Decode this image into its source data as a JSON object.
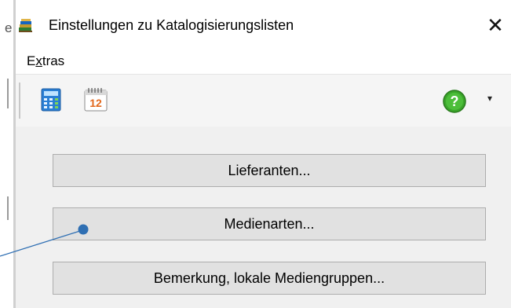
{
  "window": {
    "title": "Einstellungen zu Katalogisierungslisten",
    "close_symbol": "✕"
  },
  "background_window": {
    "partial_char": "e"
  },
  "menu": {
    "items": [
      {
        "label_pre": "E",
        "label_u": "x",
        "label_post": "tras"
      }
    ]
  },
  "toolbar": {
    "buttons": [
      {
        "icon": "calculator-icon"
      },
      {
        "icon": "calendar-icon",
        "text": "12"
      }
    ],
    "help": {
      "icon": "help-icon",
      "symbol": "?"
    },
    "help_dropdown": {
      "icon": "dropdown-arrow-icon",
      "symbol": "▾"
    }
  },
  "buttons": {
    "lieferanten": "Lieferanten...",
    "medienarten": "Medienarten...",
    "bemerkung": "Bemerkung, lokale Mediengruppen..."
  },
  "annotation": {
    "color": "#2f6fb3"
  }
}
